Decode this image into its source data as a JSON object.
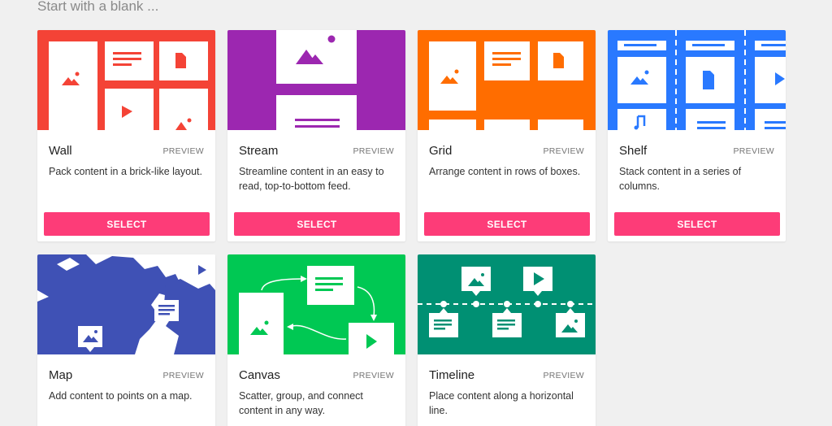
{
  "section_title": "Start with a blank ...",
  "cards": [
    {
      "title": "Wall",
      "preview": "PREVIEW",
      "description": "Pack content in a brick-like layout.",
      "select": "SELECT",
      "color": "#f44336",
      "thumb_icon": "wall-layout-icon"
    },
    {
      "title": "Stream",
      "preview": "PREVIEW",
      "description": "Streamline content in an easy to read, top-to-bottom feed.",
      "select": "SELECT",
      "color": "#9c27b0",
      "thumb_icon": "stream-layout-icon"
    },
    {
      "title": "Grid",
      "preview": "PREVIEW",
      "description": "Arrange content in rows of boxes.",
      "select": "SELECT",
      "color": "#ff6d00",
      "thumb_icon": "grid-layout-icon"
    },
    {
      "title": "Shelf",
      "preview": "PREVIEW",
      "description": "Stack content in a series of columns.",
      "select": "SELECT",
      "color": "#2979ff",
      "thumb_icon": "shelf-layout-icon"
    },
    {
      "title": "Map",
      "preview": "PREVIEW",
      "description": "Add content to points on a map.",
      "color": "#3f51b5",
      "thumb_icon": "map-layout-icon"
    },
    {
      "title": "Canvas",
      "preview": "PREVIEW",
      "description": "Scatter, group, and connect content in any way.",
      "color": "#00c853",
      "thumb_icon": "canvas-layout-icon"
    },
    {
      "title": "Timeline",
      "preview": "PREVIEW",
      "description": "Place content along a horizontal line.",
      "color": "#009073",
      "thumb_icon": "timeline-layout-icon"
    }
  ],
  "accent_color": "#fd3c78"
}
